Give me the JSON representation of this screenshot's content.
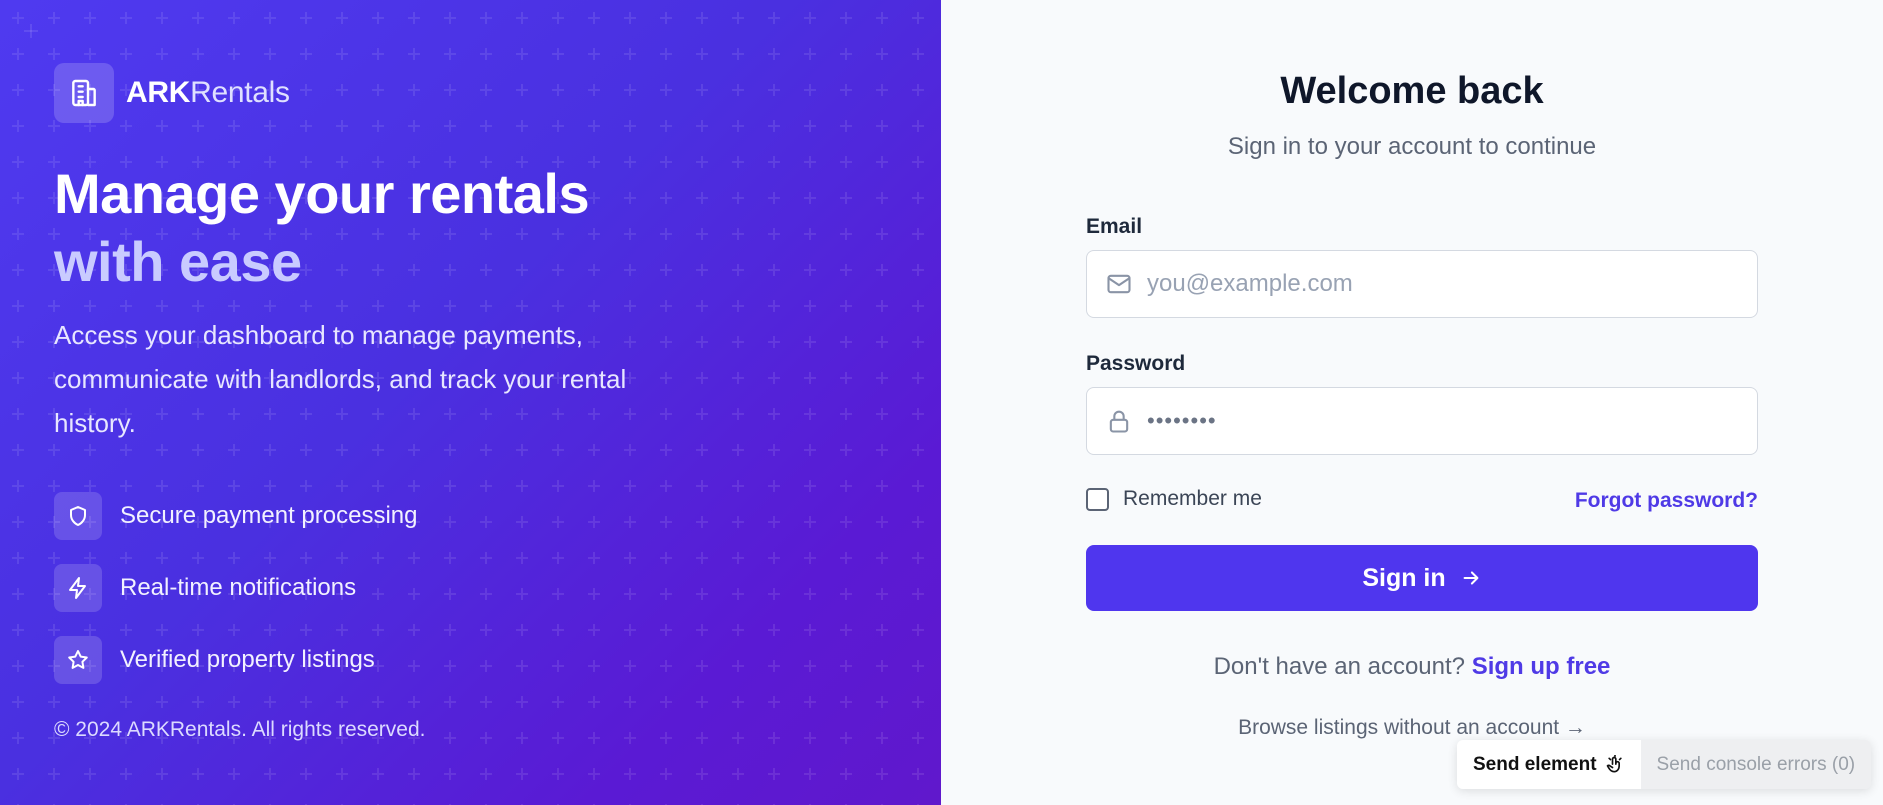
{
  "brand": {
    "name_bold": "ARK",
    "name_light": "Rentals"
  },
  "hero": {
    "headline_line1": "Manage your rentals",
    "headline_line2": "with ease",
    "lead": "Access your dashboard to manage payments, communicate with landlords, and track your rental history."
  },
  "features": [
    {
      "icon": "shield-icon",
      "label": "Secure payment processing"
    },
    {
      "icon": "lightning-icon",
      "label": "Real-time notifications"
    },
    {
      "icon": "star-icon",
      "label": "Verified property listings"
    }
  ],
  "footer": {
    "copyright": "© 2024 ARKRentals. All rights reserved."
  },
  "login": {
    "title": "Welcome back",
    "subtitle": "Sign in to your account to continue",
    "email_label": "Email",
    "email_placeholder": "you@example.com",
    "password_label": "Password",
    "password_value": "••••••••",
    "remember_label": "Remember me",
    "forgot_label": "Forgot password?",
    "signin_label": "Sign in",
    "no_account_text": "Don't have an account?",
    "signup_label": "Sign up free",
    "browse_label": "Browse listings without an account →"
  },
  "devbar": {
    "send_element": "Send element",
    "send_console_errors": "Send console errors (0)"
  },
  "colors": {
    "accent": "#4f36ee",
    "link": "#4f3ae6",
    "gradient_start": "#4f3af0",
    "gradient_end": "#6018cc"
  }
}
